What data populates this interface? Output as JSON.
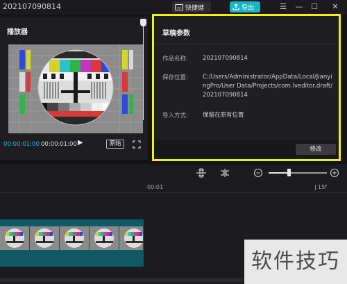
{
  "titlebar": {
    "project_name": "202107090814",
    "shortcut_label": "快捷键",
    "export_label": "导出"
  },
  "player": {
    "title": "播放器",
    "current_time": "00:00:01:00",
    "total_time": "00:00:01:00",
    "ratio_label": "原始"
  },
  "draft": {
    "title": "草稿参数",
    "rows": [
      {
        "label": "作品名称:",
        "value": "202107090814"
      },
      {
        "label": "保存位置:",
        "value": "C:/Users/Administrator/AppData/Local/JianyingPro/User Data/Projects/com.lveditor.draft/202107090814"
      },
      {
        "label": "导入方式:",
        "value": "保留在原有位置"
      }
    ],
    "edit_label": "修改"
  },
  "timeline": {
    "ruler": [
      "00:01",
      "15f"
    ],
    "zoom_level": 0.34
  },
  "watermark": "软件技巧",
  "colors": {
    "accent": "#16b6c9",
    "highlight_border": "#f3ef14",
    "clip_track": "#1a6f78"
  }
}
